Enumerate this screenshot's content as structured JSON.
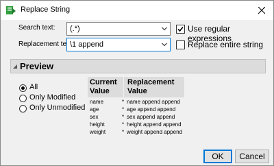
{
  "window": {
    "title": "Replace String"
  },
  "form": {
    "search_label": "Search text:",
    "search_value": "(.*)",
    "replacement_label": "Replacement text:",
    "replacement_value": "\\1 append"
  },
  "options": {
    "regex_label": "Use regular expressions",
    "regex_checked": true,
    "entire_label": "Replace entire string",
    "entire_checked": false
  },
  "preview": {
    "title": "Preview",
    "filters": [
      {
        "label": "All",
        "selected": true
      },
      {
        "label": "Only Modified",
        "selected": false
      },
      {
        "label": "Only Unmodified",
        "selected": false
      }
    ],
    "columns": {
      "current": "Current Value",
      "replacement": "Replacement Value"
    },
    "rows": [
      {
        "current": "name",
        "mark": "*",
        "replacement": "name append append"
      },
      {
        "current": "age",
        "mark": "*",
        "replacement": "age append append"
      },
      {
        "current": "sex",
        "mark": "*",
        "replacement": "sex append append"
      },
      {
        "current": "height",
        "mark": "*",
        "replacement": "height append append"
      },
      {
        "current": "weight",
        "mark": "*",
        "replacement": "weight append append"
      }
    ]
  },
  "buttons": {
    "ok": "OK",
    "cancel": "Cancel"
  },
  "colors": {
    "accent": "#0078d7",
    "app_icon": "#2e9e3e"
  }
}
